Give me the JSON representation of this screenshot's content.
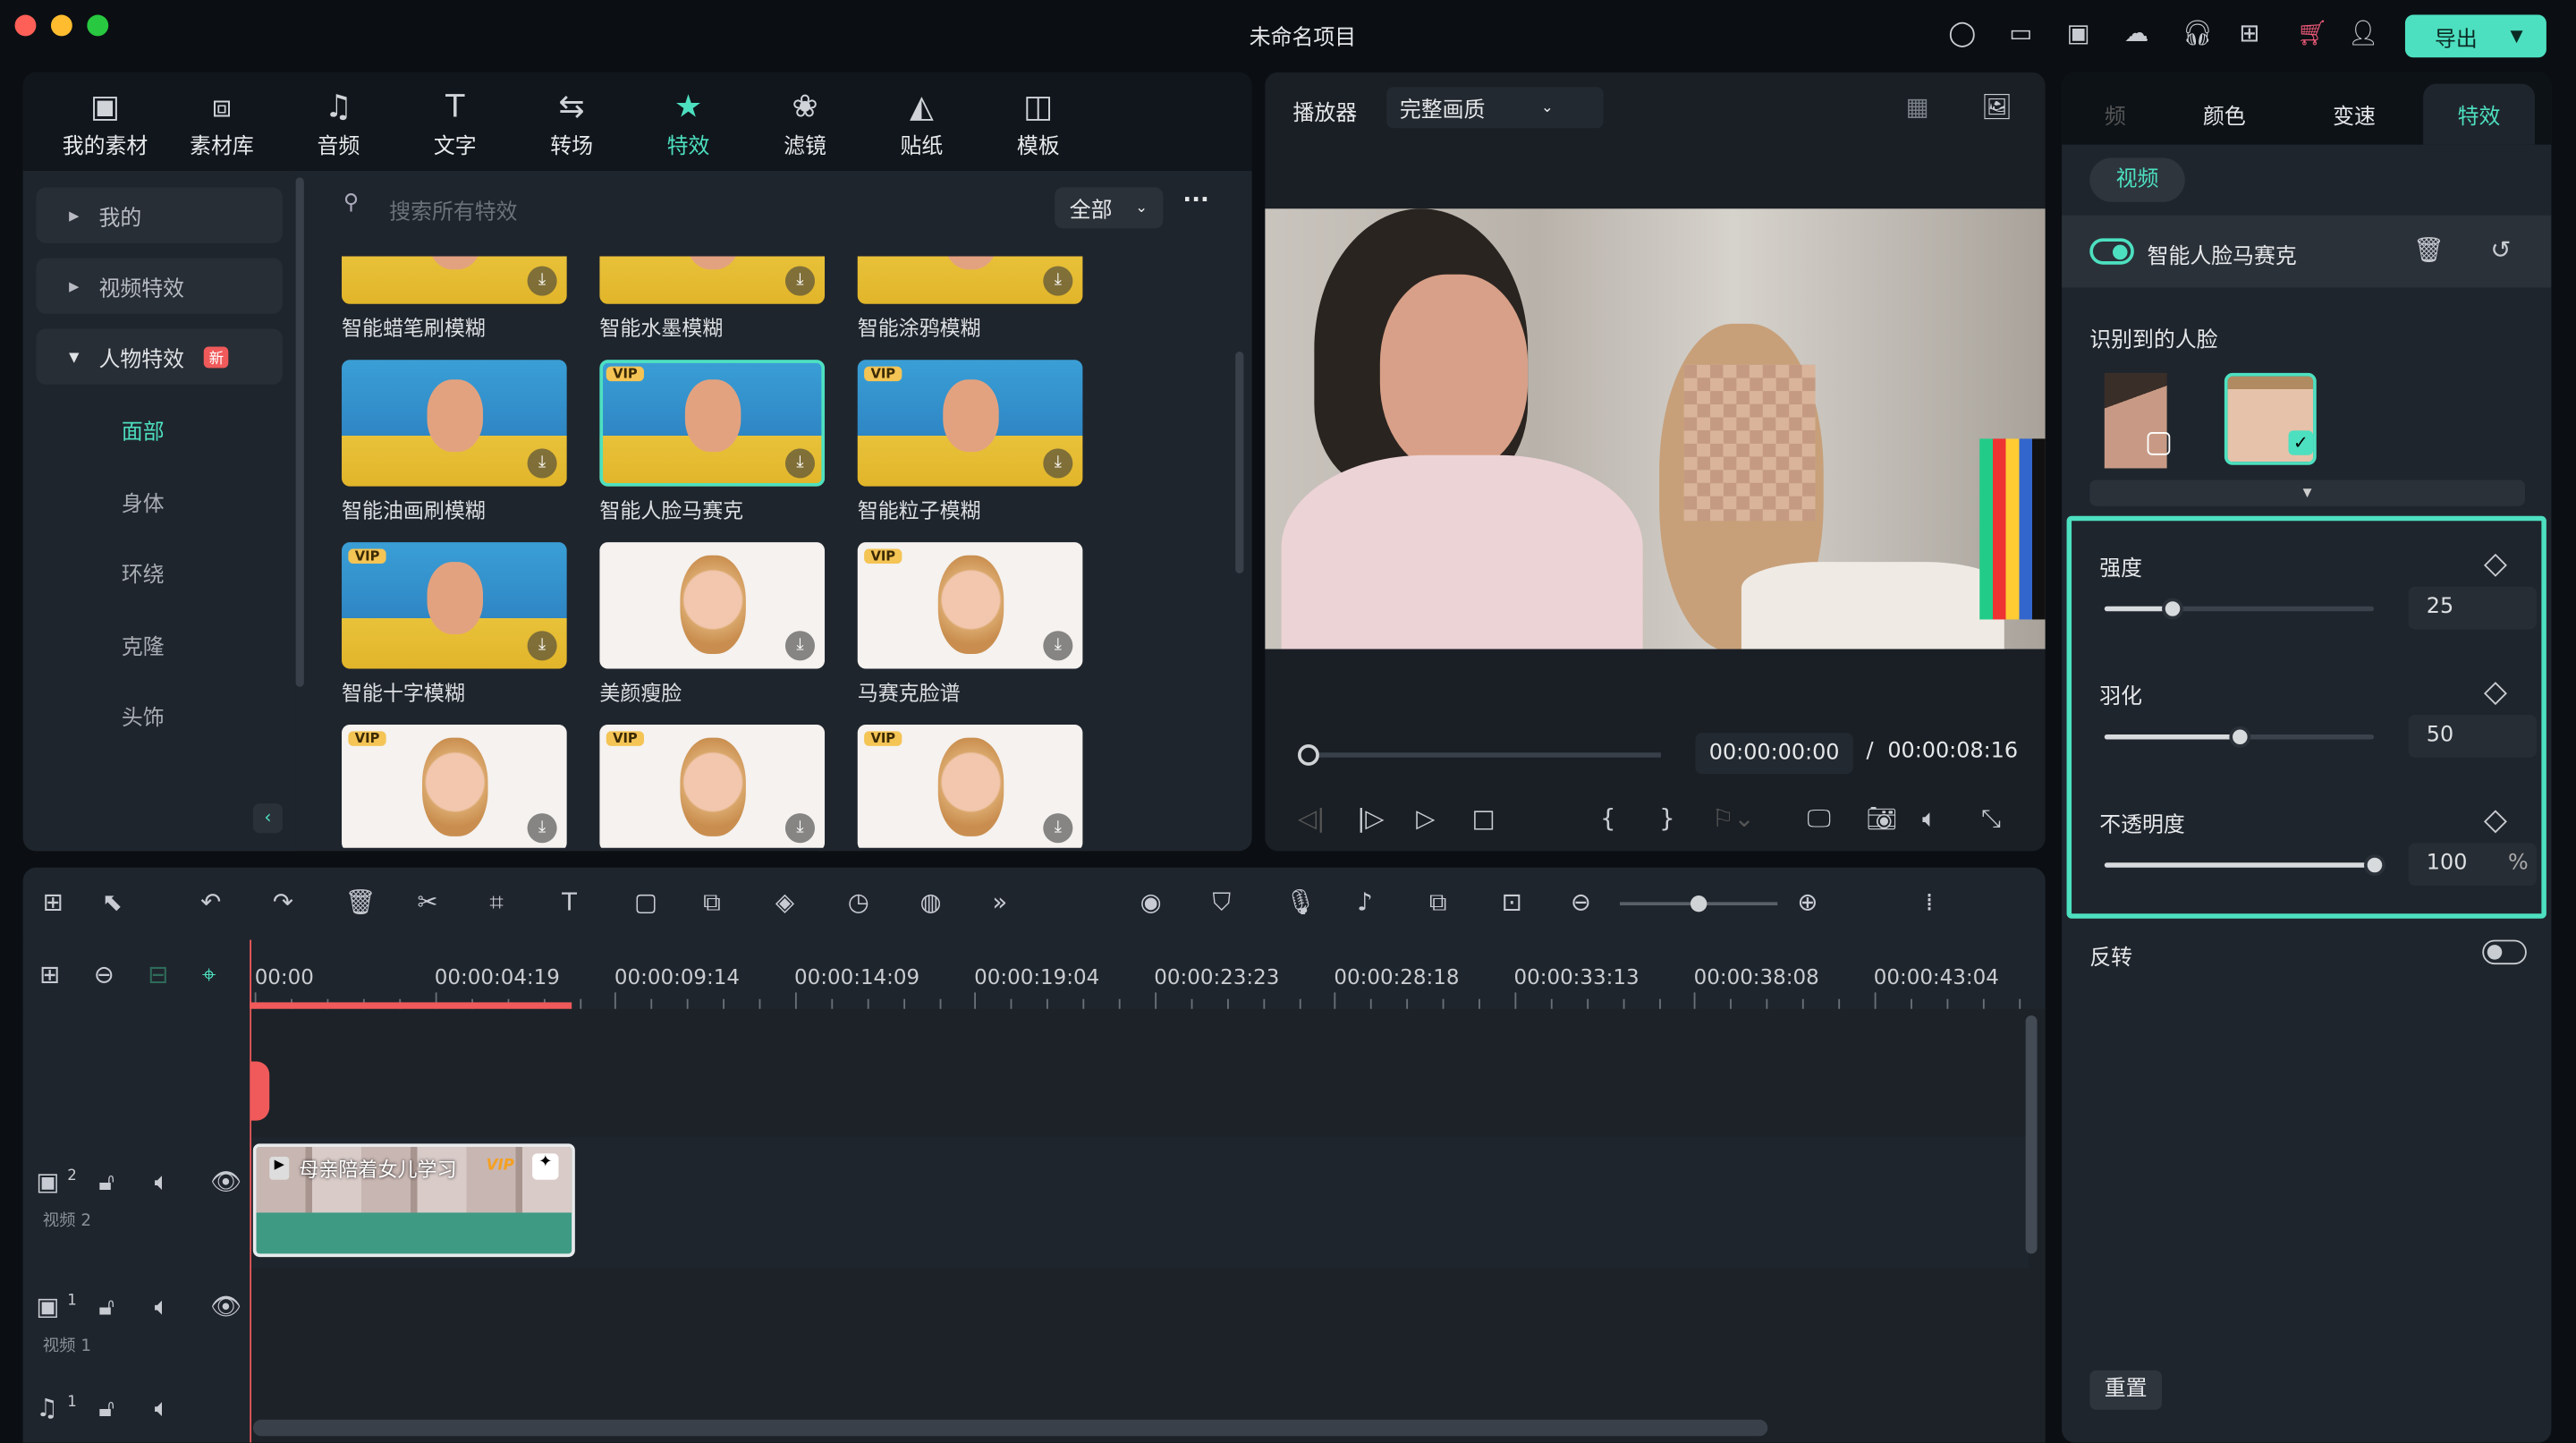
{
  "window": {
    "title": "未命名项目",
    "export_label": "导出"
  },
  "media_tabs": [
    {
      "label": "我的素材",
      "icon": "my-media-icon"
    },
    {
      "label": "素材库",
      "icon": "library-icon"
    },
    {
      "label": "音频",
      "icon": "music-icon"
    },
    {
      "label": "文字",
      "icon": "text-icon"
    },
    {
      "label": "转场",
      "icon": "transition-icon"
    },
    {
      "label": "特效",
      "icon": "effects-icon",
      "active": true
    },
    {
      "label": "滤镜",
      "icon": "filter-icon"
    },
    {
      "label": "贴纸",
      "icon": "sticker-icon"
    },
    {
      "label": "模板",
      "icon": "template-icon"
    }
  ],
  "sidebar": {
    "items": [
      {
        "label": "我的"
      },
      {
        "label": "视频特效"
      },
      {
        "label": "人物特效",
        "badge": "新"
      }
    ],
    "sub_items": [
      "面部",
      "身体",
      "环绕",
      "克隆",
      "头饰"
    ],
    "active_sub": "面部"
  },
  "search": {
    "placeholder": "搜索所有特效",
    "filter": "全部"
  },
  "effects": [
    {
      "name": "智能蜡笔刷模糊",
      "style": "blue",
      "vip": false
    },
    {
      "name": "智能水墨模糊",
      "style": "blue",
      "vip": false
    },
    {
      "name": "智能涂鸦模糊",
      "style": "blue",
      "vip": false
    },
    {
      "name": "智能油画刷模糊",
      "style": "blue",
      "vip": false
    },
    {
      "name": "智能人脸马赛克",
      "style": "blue",
      "vip": true,
      "selected": true
    },
    {
      "name": "智能粒子模糊",
      "style": "blue",
      "vip": true
    },
    {
      "name": "智能十字模糊",
      "style": "blue",
      "vip": true
    },
    {
      "name": "美颜瘦脸",
      "style": "white",
      "vip": false
    },
    {
      "name": "马赛克脸谱",
      "style": "white",
      "vip": true
    },
    {
      "name": "",
      "style": "white",
      "vip": true
    },
    {
      "name": "",
      "style": "white",
      "vip": true
    },
    {
      "name": "",
      "style": "white",
      "vip": true
    }
  ],
  "vip_label": "VIP",
  "player": {
    "label": "播放器",
    "quality": "完整画质",
    "current_time": "00:00:00:00",
    "separator": "/",
    "total_time": "00:00:08:16",
    "progress": 0
  },
  "right_panel": {
    "tabs": [
      "频",
      "颜色",
      "变速",
      "特效"
    ],
    "active_tab": "特效",
    "sub_tab": "视频",
    "effect_name": "智能人脸马赛克",
    "effect_enabled": true,
    "faces_label": "识别到的人脸",
    "params": [
      {
        "label": "强度",
        "value": 25,
        "max": 100,
        "unit": ""
      },
      {
        "label": "羽化",
        "value": 50,
        "max": 100,
        "unit": ""
      },
      {
        "label": "不透明度",
        "value": 100,
        "max": 100,
        "unit": "%"
      }
    ],
    "invert_label": "反转",
    "invert_on": false,
    "reset_label": "重置"
  },
  "timeline": {
    "ticks": [
      "00:00",
      "00:00:04:19",
      "00:00:09:14",
      "00:00:14:09",
      "00:00:19:04",
      "00:00:23:23",
      "00:00:28:18",
      "00:00:33:13",
      "00:00:38:08",
      "00:00:43:04"
    ],
    "tracks": [
      {
        "num": "2",
        "name": "视频 2"
      },
      {
        "num": "1",
        "name": "视频 1"
      },
      {
        "num": "1",
        "name": ""
      }
    ],
    "clip": {
      "title": "母亲陪着女儿学习",
      "badge": "VIP"
    }
  },
  "colors": {
    "accent": "#4de0c0",
    "playhead": "#f05a5a",
    "vip": "#f4c455"
  }
}
